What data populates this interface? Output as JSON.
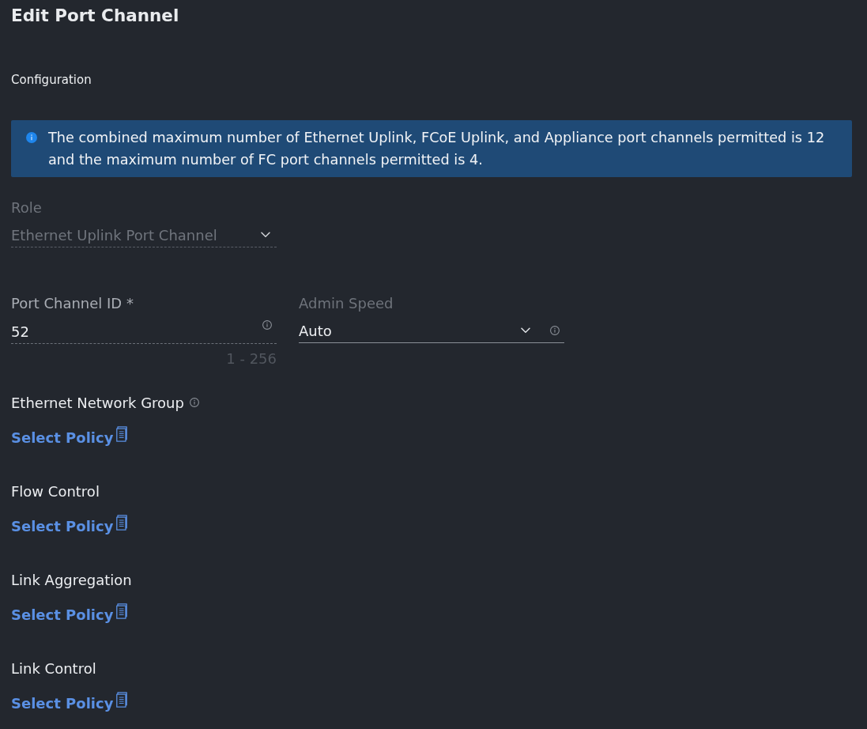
{
  "page": {
    "title": "Edit Port Channel",
    "section": "Configuration"
  },
  "info_banner": {
    "text": "The combined maximum number of Ethernet Uplink, FCoE Uplink, and Appliance port channels permitted is 12 and the maximum number of FC port channels permitted is 4."
  },
  "field_rows": [
    [
      {
        "kind": "select",
        "label": "Role",
        "value": "Ethernet Uplink Port Channel",
        "disabled": true,
        "info": false
      }
    ],
    [
      {
        "kind": "text",
        "label": "Port Channel ID *",
        "value": "52",
        "hint": "1 - 256",
        "disabled": false,
        "info": true
      },
      {
        "kind": "select",
        "label": "Admin Speed",
        "value": "Auto",
        "disabled": false,
        "info": true
      }
    ]
  ],
  "policies": [
    {
      "label": "Ethernet Network Group",
      "info": true,
      "link": "Select Policy"
    },
    {
      "label": "Flow Control",
      "info": false,
      "link": "Select Policy"
    },
    {
      "label": "Link Aggregation",
      "info": false,
      "link": "Select Policy"
    },
    {
      "label": "Link Control",
      "info": false,
      "link": "Select Policy"
    }
  ]
}
